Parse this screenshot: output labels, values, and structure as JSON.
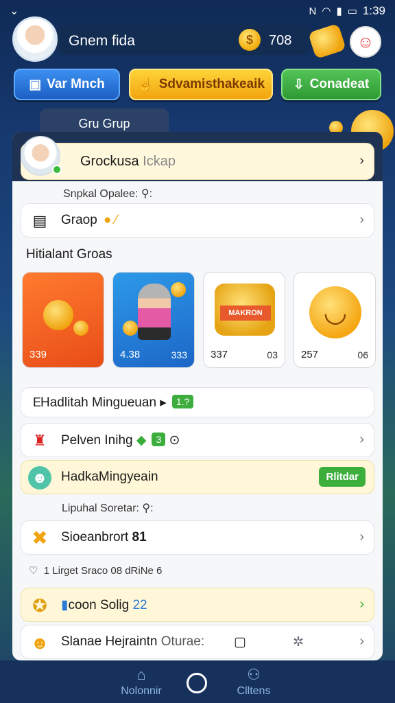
{
  "status_bar": {
    "left_glyph": "⌄",
    "time": "1:39"
  },
  "header": {
    "player_name": "Gnem fida",
    "coin_count": "708",
    "coin_symbol": "$"
  },
  "action_buttons": [
    {
      "label": "Var Mnch",
      "icon": "lock-icon"
    },
    {
      "label": "Sdvamisthakeaik",
      "icon": "hand-icon"
    },
    {
      "label": "Conadeat",
      "icon": "download-icon"
    }
  ],
  "tab_label": "Gru Grup",
  "group": {
    "name": "Grockusa",
    "name_suffix": "Ickap"
  },
  "section1_label": "Snpkal Opalee: ⚲:",
  "group_row_label": "Graop",
  "recent_title": "Hitialant Groas",
  "cards": [
    {
      "a": "339",
      "b": ""
    },
    {
      "a": "4.38",
      "b": "333"
    },
    {
      "a": "337",
      "b": "03",
      "ribbon": "MAKRON"
    },
    {
      "a": "257",
      "b": "06"
    }
  ],
  "rows_a": [
    {
      "label": "Hadlitah Mingueuan",
      "badge": "1.?"
    },
    {
      "label": "Pelven Inihg",
      "badge": "3"
    },
    {
      "label": "HadkaMingyeain",
      "button": "Rlitdar"
    }
  ],
  "section2_label": "Lipuhal Soretar: ⚲:",
  "rows_b": [
    {
      "label": "Sioeanbrort",
      "suffix": "81"
    },
    {
      "label": "1 Lirget Sraco 08 dRiNe 6"
    },
    {
      "label": "coon Solig",
      "suffix": "22"
    },
    {
      "label": "Slanae Hejraintn",
      "suffix": "Oturae:"
    }
  ],
  "nav": [
    {
      "label": "Nolonnir",
      "icon": "home-icon"
    },
    {
      "label": "",
      "icon": "circle-home-icon"
    },
    {
      "label": "Clltens",
      "icon": "person-icon"
    }
  ],
  "colors": {
    "blue_button": "#1d5fc4",
    "yellow_button": "#f2a40f",
    "green_button": "#2e9a33",
    "panel": "#f6f7f9"
  }
}
